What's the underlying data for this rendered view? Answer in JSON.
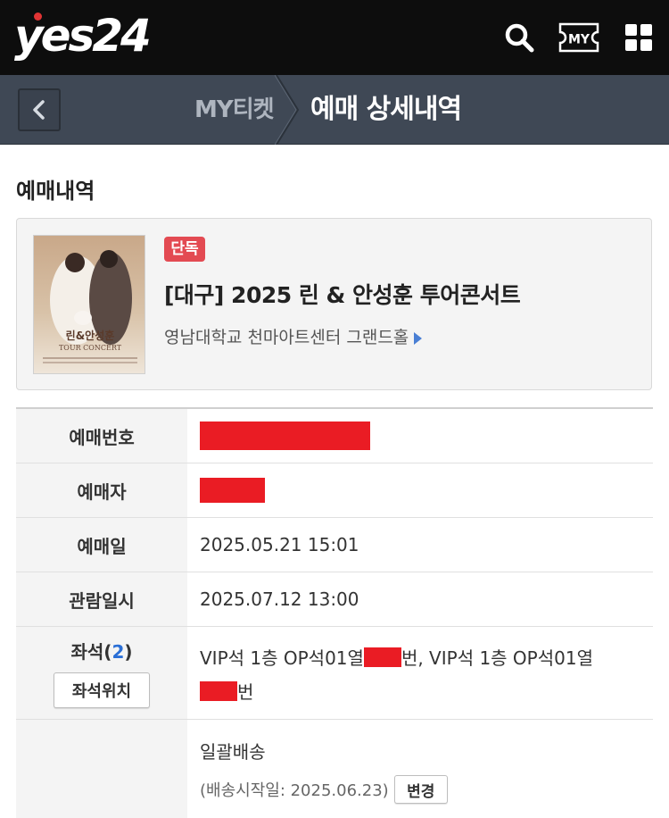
{
  "header": {
    "logo": "yes24",
    "my_label": "MY"
  },
  "subheader": {
    "parent": "MY티켓",
    "current": "예매 상세내역"
  },
  "section_title": "예매내역",
  "event": {
    "badge": "단독",
    "title": "[대구] 2025 린 & 안성훈 투어콘서트",
    "venue": "영남대학교 천마아트센터 그랜드홀",
    "poster": {
      "headline": "린&안성훈",
      "subtitle": "TOUR CONCERT"
    }
  },
  "details": {
    "booking_number_label": "예매번호",
    "booker_label": "예매자",
    "booking_date_label": "예매일",
    "booking_date": "2025.05.21 15:01",
    "viewing_date_label": "관람일시",
    "viewing_date": "2025.07.12 13:00",
    "seats_label": "좌석(",
    "seats_count": "2",
    "seats_label_close": ")",
    "seat_map_button": "좌석위치",
    "seat_1_prefix": "VIP석 1층 OP석01열",
    "seat_1_suffix": "번, VIP석 1층 OP석01열",
    "seat_2_suffix": "번",
    "delivery_method": "일괄배송",
    "delivery_start": "(배송시작일: 2025.06.23)",
    "change_button": "변경"
  },
  "colors": {
    "topbar": "#0d0d0d",
    "subbar": "#3f4855",
    "badge": "#e34a52",
    "redaction": "#ea1c24",
    "accent_blue": "#2a6fd6"
  }
}
